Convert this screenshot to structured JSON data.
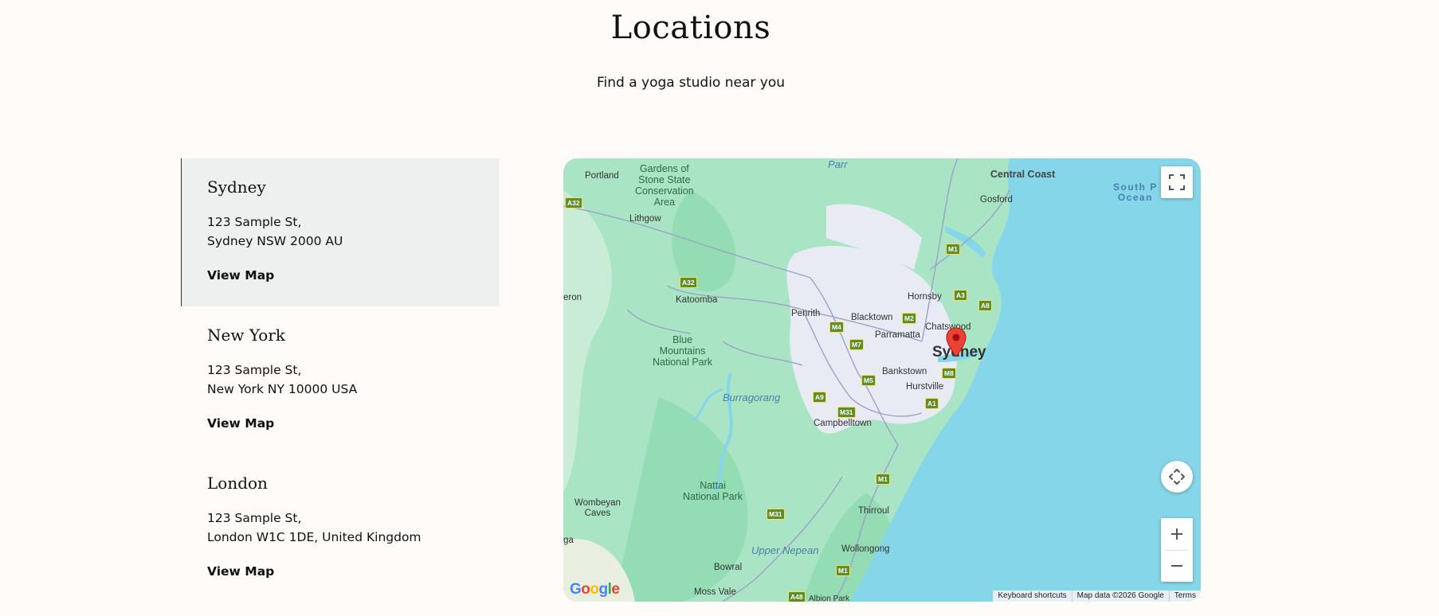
{
  "header": {
    "title": "Locations",
    "subtitle": "Find a yoga studio near you"
  },
  "locations": [
    {
      "name": "Sydney",
      "address_line1": "123 Sample St,",
      "address_line2": "Sydney NSW 2000 AU",
      "link": "View Map",
      "active": true
    },
    {
      "name": "New York",
      "address_line1": "123 Sample St,",
      "address_line2": "New York NY 10000 USA",
      "link": "View Map",
      "active": false
    },
    {
      "name": "London",
      "address_line1": "123 Sample St,",
      "address_line2": "London W1C 1DE, United Kingdom",
      "link": "View Map",
      "active": false
    }
  ],
  "map": {
    "logo": "Google",
    "attribution": {
      "shortcuts": "Keyboard shortcuts",
      "data": "Map data ©2026 Google",
      "terms": "Terms"
    },
    "labels": {
      "portland": "Portland",
      "gardens": "Gardens of\nStone State\nConservation\nArea",
      "parr": "Parr",
      "central_coast": "Central Coast",
      "gosford": "Gosford",
      "south_pacific": "South P\nOcean",
      "lithgow": "Lithgow",
      "katoomba": "Katoomba",
      "eron": "eron",
      "penrith": "Penrith",
      "blacktown": "Blacktown",
      "hornsby": "Hornsby",
      "chatswood": "Chatswood",
      "parramatta": "Parramatta",
      "sydney": "Sydney",
      "blue_mountains": "Blue\nMountains\nNational Park",
      "bankstown": "Bankstown",
      "hurstville": "Hurstville",
      "burragorang": "Burragorang",
      "campbelltown": "Campbelltown",
      "nattai": "Nattai\nNational Park",
      "wombeyan": "Wombeyan\nCaves",
      "thirroul": "Thirroul",
      "upper_nepean": "Upper Nepean",
      "wollongong": "Wollongong",
      "bowral": "Bowral",
      "moss_vale": "Moss Vale",
      "albion_park": "Albion Park",
      "ga": "ga"
    },
    "shields": [
      "A32",
      "A32",
      "M1",
      "A3",
      "A8",
      "M2",
      "M4",
      "M7",
      "M5",
      "M8",
      "A9",
      "A1",
      "M31",
      "M31",
      "M1",
      "M1",
      "A48"
    ],
    "icons": {
      "fullscreen": "fullscreen-icon",
      "camera": "camera-control-icon",
      "zoom_in": "plus-icon",
      "zoom_out": "minus-icon",
      "marker": "map-pin-icon"
    },
    "colors": {
      "water": "#86d6ea",
      "park": "#a8e6c4",
      "urban": "#e8ebf3",
      "marker": "#ea4335"
    }
  }
}
